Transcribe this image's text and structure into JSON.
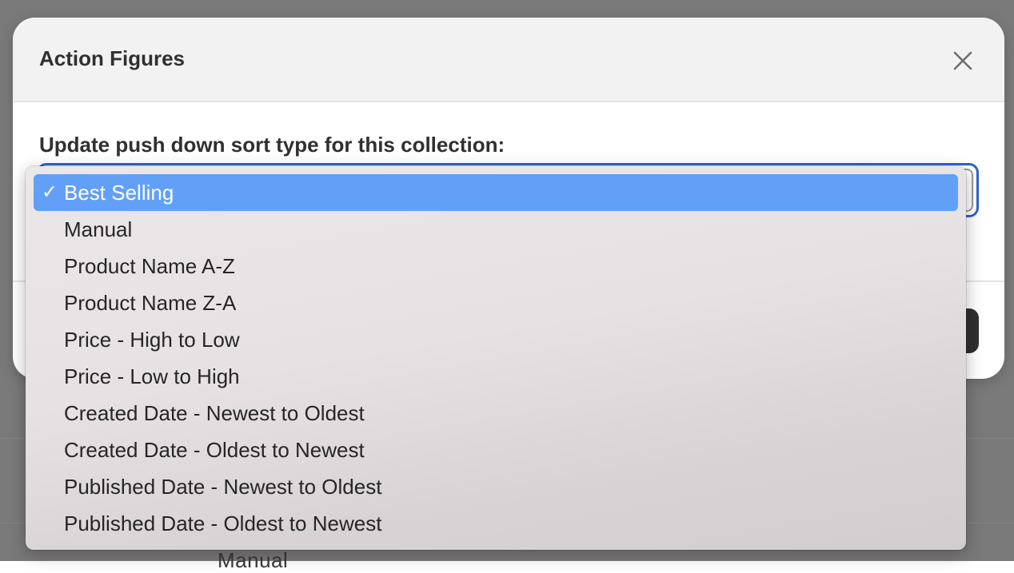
{
  "modal": {
    "title": "Action Figures",
    "prompt": "Update push down sort type for this collection:"
  },
  "select": {
    "selected_value": "Best Selling",
    "check_mark": "✓",
    "options": [
      "Best Selling",
      "Manual",
      "Product Name A-Z",
      "Product Name Z-A",
      "Price - High to Low",
      "Price - Low to High",
      "Created Date - Newest to Oldest",
      "Created Date - Oldest to Newest",
      "Published Date - Newest to Oldest",
      "Published Date - Oldest to Newest"
    ]
  },
  "background": {
    "partial_text": "Manual"
  },
  "icons": {
    "close": "close-icon",
    "check": "checkmark-icon"
  },
  "colors": {
    "focus_ring": "#2d62d1",
    "selected_highlight": "#62a0f8",
    "overlay": "#7a7a7a"
  }
}
